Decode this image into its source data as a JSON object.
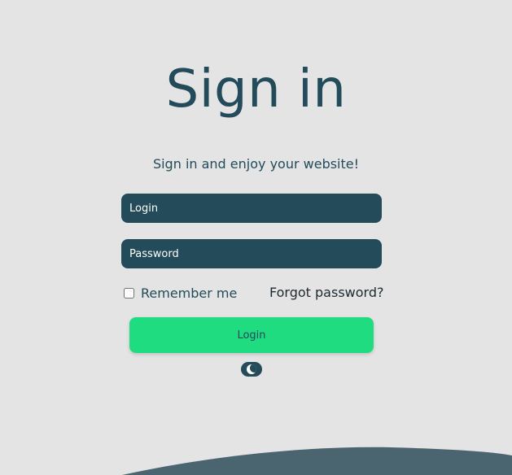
{
  "header": {
    "title": "Sign in",
    "subtitle": "Sign in and enjoy your website!"
  },
  "form": {
    "login_placeholder": "Login",
    "login_value": "",
    "password_placeholder": "Password",
    "password_value": "",
    "remember_label": "Remember me",
    "remember_checked": false,
    "forgot_label": "Forgot password?",
    "submit_label": "Login"
  },
  "theme_toggle": {
    "icon": "moon-icon"
  },
  "colors": {
    "background": "#e4e4e4",
    "primary": "#234b5a",
    "accent": "#1fdc80",
    "wave": "#4b6570"
  }
}
